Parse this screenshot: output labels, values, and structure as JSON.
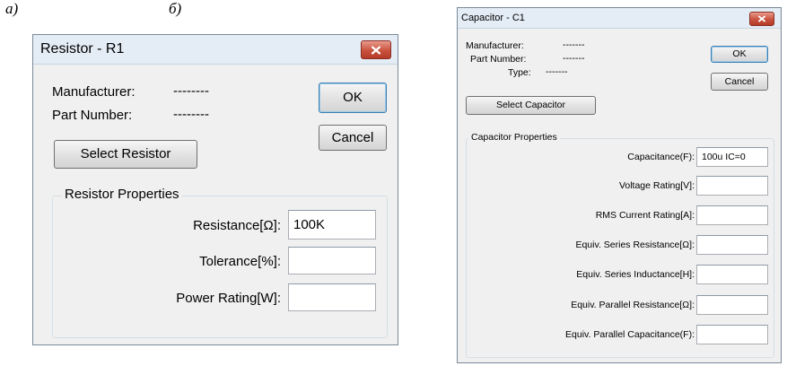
{
  "labels": {
    "a": "а)",
    "b": "б)"
  },
  "dialog_a": {
    "title": "Resistor - R1",
    "manufacturer_label": "Manufacturer:",
    "manufacturer_value": "--------",
    "part_number_label": "Part Number:",
    "part_number_value": "--------",
    "ok_label": "OK",
    "cancel_label": "Cancel",
    "select_label": "Select Resistor",
    "group_title": "Resistor Properties",
    "fields": [
      {
        "label": "Resistance[Ω]:",
        "value": "100K"
      },
      {
        "label": "Tolerance[%]:",
        "value": ""
      },
      {
        "label": "Power Rating[W]:",
        "value": ""
      }
    ]
  },
  "dialog_b": {
    "title": "Capacitor - C1",
    "manufacturer_label": "Manufacturer:",
    "manufacturer_value": "-------",
    "part_number_label": "Part Number:",
    "part_number_value": "-------",
    "type_label": "Type:",
    "type_value": "-------",
    "ok_label": "OK",
    "cancel_label": "Cancel",
    "select_label": "Select Capacitor",
    "group_title": "Capacitor Properties",
    "fields": [
      {
        "label": "Capacitance(F):",
        "value": "100u IC=0"
      },
      {
        "label": "Voltage Rating[V]:",
        "value": ""
      },
      {
        "label": "RMS Current Rating[A]:",
        "value": ""
      },
      {
        "label": "Equiv. Series Resistance[Ω]:",
        "value": ""
      },
      {
        "label": "Equiv. Series Inductance[H]:",
        "value": ""
      },
      {
        "label": "Equiv. Parallel Resistance[Ω]:",
        "value": ""
      },
      {
        "label": "Equiv. Parallel Capacitance(F):",
        "value": ""
      }
    ]
  },
  "colors": {
    "dialog_bg": "#f0f0f0",
    "close_button": "#c9523e",
    "default_button_border": "#3c7fb1"
  }
}
